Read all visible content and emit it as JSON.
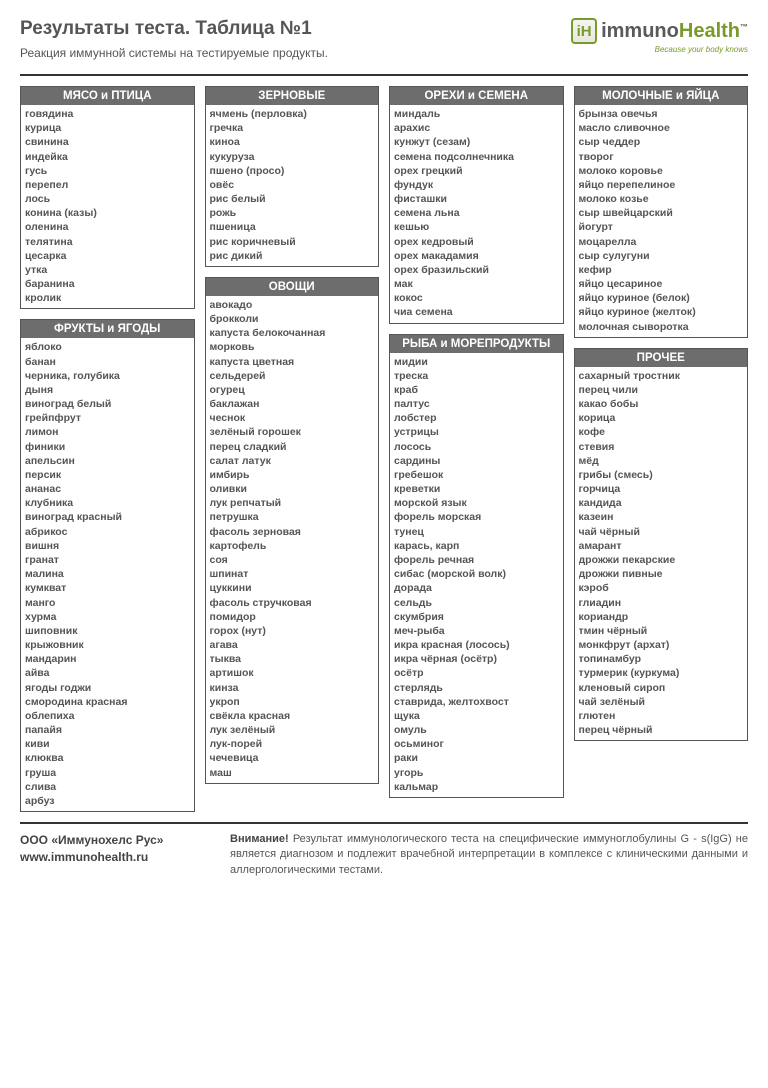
{
  "header": {
    "title": "Результаты теста. Таблица №1",
    "subtitle": "Реакция иммунной системы на тестируемые продукты."
  },
  "logo": {
    "brand_prefix": "immuno",
    "brand_suffix": "Health",
    "tagline": "Because your body knows",
    "tm": "™"
  },
  "columns": [
    [
      {
        "title": "МЯСО и ПТИЦА",
        "items": [
          "говядина",
          "курица",
          "свинина",
          "индейка",
          "гусь",
          "перепел",
          "лось",
          "конина (казы)",
          "оленина",
          "телятина",
          "цесарка",
          "утка",
          "баранина",
          "кролик"
        ]
      },
      {
        "title": "ФРУКТЫ и ЯГОДЫ",
        "items": [
          "яблоко",
          "банан",
          "черника, голубика",
          "дыня",
          "виноград белый",
          "грейпфрут",
          "лимон",
          "финики",
          "апельсин",
          "персик",
          "ананас",
          "клубника",
          "виноград красный",
          "абрикос",
          "вишня",
          "гранат",
          "малина",
          "кумкват",
          "манго",
          "хурма",
          "шиповник",
          "крыжовник",
          "мандарин",
          "айва",
          "ягоды годжи",
          "смородина красная",
          "облепиха",
          "папайя",
          "киви",
          "клюква",
          "груша",
          "слива",
          "арбуз"
        ]
      }
    ],
    [
      {
        "title": "ЗЕРНОВЫЕ",
        "items": [
          "ячмень (перловка)",
          "гречка",
          "киноа",
          "кукуруза",
          "пшено (просо)",
          "овёс",
          "рис белый",
          "рожь",
          "пшеница",
          "рис коричневый",
          "рис дикий"
        ]
      },
      {
        "title": "ОВОЩИ",
        "items": [
          "авокадо",
          "брокколи",
          "капуста белокочанная",
          "морковь",
          "капуста цветная",
          "сельдерей",
          "огурец",
          "баклажан",
          "чеснок",
          "зелёный горошек",
          "перец сладкий",
          "салат латук",
          "имбирь",
          "оливки",
          "лук репчатый",
          "петрушка",
          "фасоль зерновая",
          "картофель",
          "соя",
          "шпинат",
          "цуккини",
          "фасоль стручковая",
          "помидор",
          "горох (нут)",
          "агава",
          "тыква",
          "артишок",
          "кинза",
          "укроп",
          "свёкла красная",
          "лук зелёный",
          "лук-порей",
          "чечевица",
          "маш"
        ]
      }
    ],
    [
      {
        "title": "ОРЕХИ и СЕМЕНА",
        "items": [
          "миндаль",
          "арахис",
          "кунжут (сезам)",
          "семена подсолнечника",
          "орех грецкий",
          "фундук",
          "фисташки",
          "семена льна",
          "кешью",
          "орех кедровый",
          "орех макадамия",
          "орех бразильский",
          "мак",
          "кокос",
          "чиа семена"
        ]
      },
      {
        "title": "РЫБА и МОРЕПРОДУКТЫ",
        "items": [
          "мидии",
          "треска",
          "краб",
          "палтус",
          "лобстер",
          "устрицы",
          "лосось",
          "сардины",
          "гребешок",
          "креветки",
          "морской язык",
          "форель морская",
          "тунец",
          "карась, карп",
          "форель речная",
          "сибас (морской волк)",
          "дорада",
          "сельдь",
          "скумбрия",
          "меч-рыба",
          "икра красная (лосось)",
          "икра чёрная (осётр)",
          "осётр",
          "стерлядь",
          "ставрида, желтохвост",
          "щука",
          "омуль",
          "осьминог",
          "раки",
          "угорь",
          "кальмар"
        ]
      }
    ],
    [
      {
        "title": "МОЛОЧНЫЕ и ЯЙЦА",
        "items": [
          "брынза овечья",
          "масло сливочное",
          "сыр чеддер",
          "творог",
          "молоко коровье",
          "яйцо перепелиное",
          "молоко козье",
          "сыр швейцарский",
          "йогурт",
          "моцарелла",
          "сыр сулугуни",
          "кефир",
          "яйцо цесариное",
          "яйцо куриное (белок)",
          "яйцо куриное (желток)",
          "молочная сыворотка"
        ]
      },
      {
        "title": "ПРОЧЕЕ",
        "items": [
          "сахарный тростник",
          "перец чили",
          "какао бобы",
          "корица",
          "кофе",
          "стевия",
          "мёд",
          "грибы (смесь)",
          "горчица",
          "кандида",
          "казеин",
          "чай чёрный",
          "амарант",
          "дрожжи пекарские",
          "дрожжи пивные",
          "кэроб",
          "глиадин",
          "кориандр",
          "тмин чёрный",
          "монкфрут (архат)",
          "топинамбур",
          "турмерик (куркума)",
          "кленовый сироп",
          "чай зелёный",
          "глютен",
          "перец чёрный"
        ]
      }
    ]
  ],
  "footer": {
    "company": "ООО «Иммунохелс Рус»",
    "website": "www.immunohealth.ru",
    "warning_label": "Внимание!",
    "warning_text": " Результат иммунологического теста на специфические иммуноглобулины G - s(IgG) не является диагнозом и подлежит врачебной интерпретации в комплексе с клиническими данными и аллергологическими тестами."
  }
}
